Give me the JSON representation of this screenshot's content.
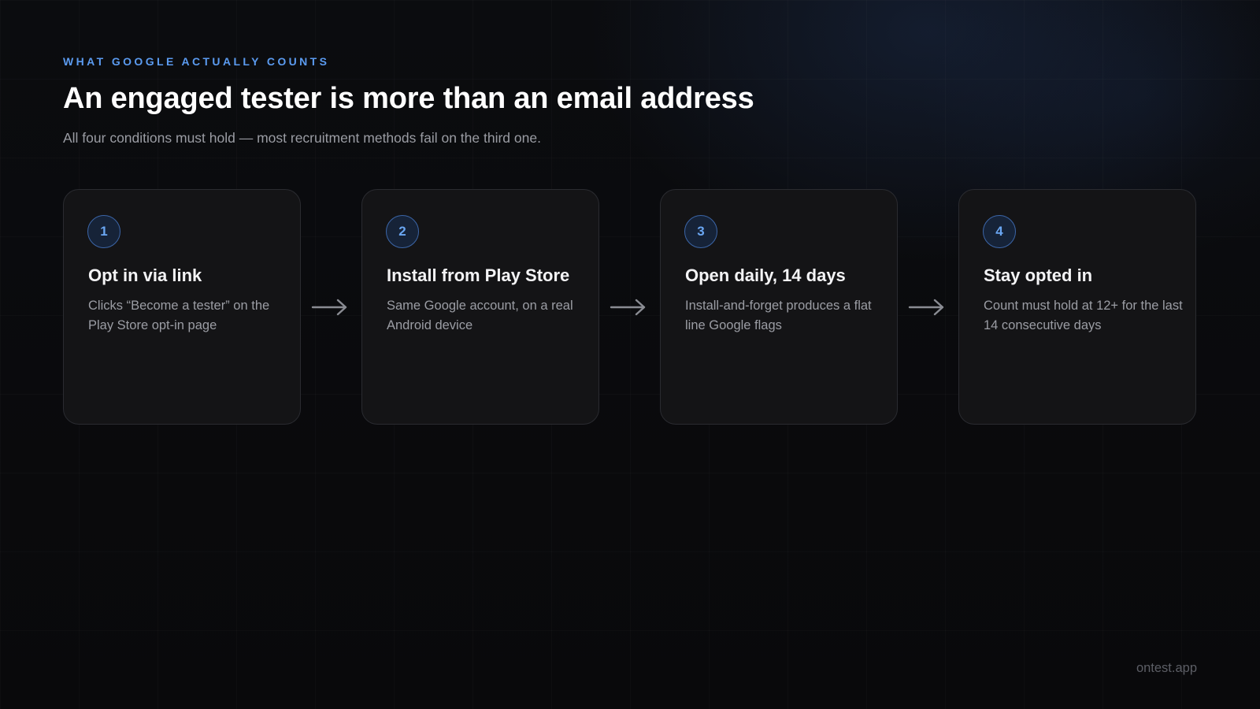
{
  "header": {
    "eyebrow": "WHAT GOOGLE ACTUALLY COUNTS",
    "title": "An engaged tester is more than an email address",
    "subtitle": "All four conditions must hold — most recruitment methods fail on the third one."
  },
  "steps": [
    {
      "number": "1",
      "title": "Opt in via link",
      "description": "Clicks “Become a tester” on the Play Store opt-in page"
    },
    {
      "number": "2",
      "title": "Install from Play Store",
      "description": "Same Google account, on a real Android device"
    },
    {
      "number": "3",
      "title": "Open daily, 14 days",
      "description": "Install-and-forget produces a flat line Google flags"
    },
    {
      "number": "4",
      "title": "Stay opted in",
      "description": "Count must hold at 12+ for the last 14 consecutive days"
    }
  ],
  "icons": {
    "connector": "arrow-right-icon"
  },
  "colors": {
    "accent": "#5b9bf0",
    "card_background": "#141416",
    "card_border": "#2a2b30",
    "badge_border": "#3c66a8"
  },
  "footer": {
    "brand": "ontest.app"
  }
}
